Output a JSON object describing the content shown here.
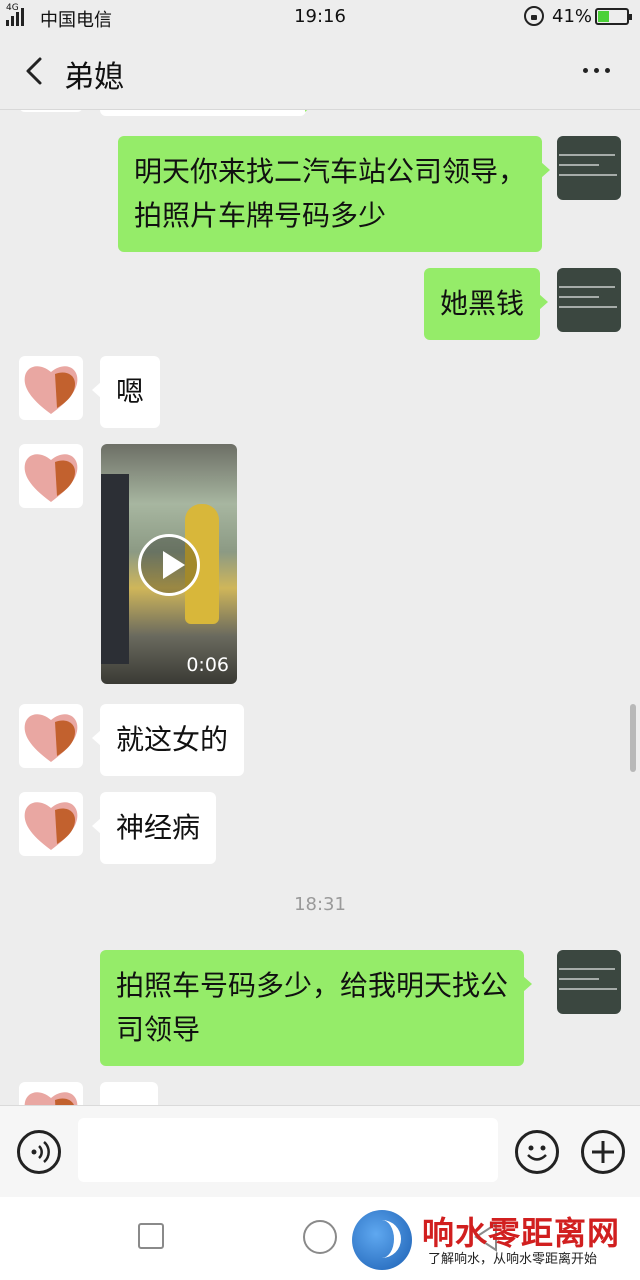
{
  "status_bar": {
    "network": "4G",
    "carrier": "中国电信",
    "time": "19:16",
    "battery_percent": "41%",
    "battery_level": 0.41
  },
  "header": {
    "title": "弟媳"
  },
  "messages": [
    {
      "from": "me",
      "text_lines": [
        "明天你来找二汽车站公司领导，",
        "拍照片车牌号码多少"
      ]
    },
    {
      "from": "me",
      "text": "她黑钱"
    },
    {
      "from": "contact",
      "text": "嗯"
    },
    {
      "from": "contact",
      "type": "video",
      "duration": "0:06"
    },
    {
      "from": "contact",
      "text": "就这女的"
    },
    {
      "from": "contact",
      "text": "神经病"
    },
    {
      "type": "timestamp",
      "text": "18:31"
    },
    {
      "from": "me",
      "text_lines": [
        "拍照车号码多少，给我明天找公",
        "司领导"
      ]
    }
  ],
  "input": {
    "value": "",
    "placeholder": ""
  },
  "watermark": {
    "title": "响水零距离网",
    "subtitle": "了解响水，从响水零距离开始"
  },
  "colors": {
    "outgoing_bubble": "#95ec69",
    "incoming_bubble": "#ffffff",
    "background": "#ededed",
    "watermark_red": "#d11f1f"
  }
}
